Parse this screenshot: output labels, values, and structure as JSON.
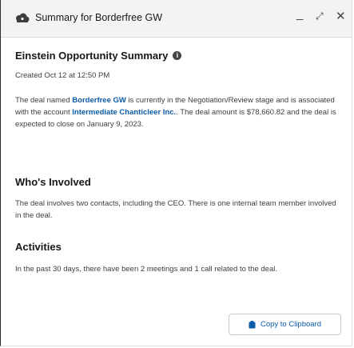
{
  "header": {
    "title": "Summary for Borderfree GW",
    "icons": [
      "einstein-opportunity-icon",
      "minimize-icon",
      "expand-icon",
      "close-icon"
    ]
  },
  "summary": {
    "heading": "Einstein Opportunity Summary",
    "created": "Created Oct 12 at 12:50 PM",
    "p1_a": "The deal named ",
    "p1_link1": "Borderfree GW",
    "p1_b": " is currently in the Negotiation/Review stage and is associated with the account ",
    "p1_link2": "Intermediate Chanticleer Inc.",
    "p1_c": ". The deal amount is $78,660.82 and the deal is expected to close on January 9, 2023."
  },
  "involved": {
    "heading": "Who's Involved",
    "text": "The deal involves two contacts, including the CEO. There is one internal team member involved in the deal."
  },
  "activities": {
    "heading": "Activities",
    "text": "In the past 30 days, there have been 2 meetings and 1 call related to the deal."
  },
  "footer": {
    "copy_label": "Copy to Clipboard"
  },
  "colors": {
    "link": "#0b5cab",
    "header_bg": "#f3f3f3"
  }
}
